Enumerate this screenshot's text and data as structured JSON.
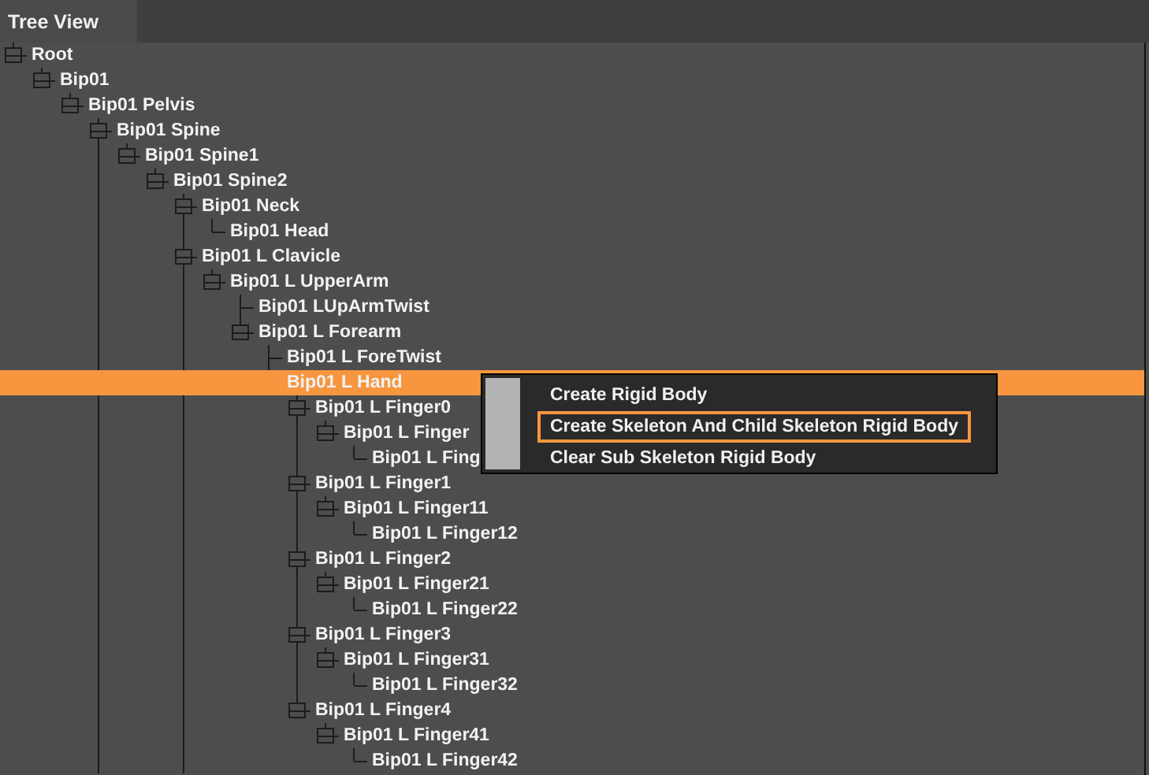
{
  "tabs": [
    {
      "label": "Tree View",
      "selected": true
    }
  ],
  "tree": [
    {
      "label": "Root",
      "selected": false,
      "children": [
        {
          "label": "Bip01",
          "selected": false,
          "children": [
            {
              "label": "Bip01 Pelvis",
              "selected": false,
              "children": [
                {
                  "label": "Bip01 Spine",
                  "selected": false,
                  "more_below": true,
                  "children": [
                    {
                      "label": "Bip01 Spine1",
                      "selected": false,
                      "children": [
                        {
                          "label": "Bip01 Spine2",
                          "selected": false,
                          "children": [
                            {
                              "label": "Bip01 Neck",
                              "selected": false,
                              "children": [
                                {
                                  "label": "Bip01 Head",
                                  "selected": false
                                }
                              ]
                            },
                            {
                              "label": "Bip01 L Clavicle",
                              "selected": false,
                              "more_below": true,
                              "children": [
                                {
                                  "label": "Bip01 L UpperArm",
                                  "selected": false,
                                  "children": [
                                    {
                                      "label": "Bip01 LUpArmTwist",
                                      "selected": false
                                    },
                                    {
                                      "label": "Bip01 L Forearm",
                                      "selected": false,
                                      "children": [
                                        {
                                          "label": "Bip01 L ForeTwist",
                                          "selected": false
                                        },
                                        {
                                          "label": "Bip01 L Hand",
                                          "selected": true,
                                          "children": [
                                            {
                                              "label": "Bip01 L Finger0",
                                              "selected": false,
                                              "children": [
                                                {
                                                  "label": "Bip01 L Finger",
                                                  "selected": false,
                                                  "children": [
                                                    {
                                                      "label": "Bip01 L Fing",
                                                      "selected": false
                                                    }
                                                  ]
                                                }
                                              ]
                                            },
                                            {
                                              "label": "Bip01 L Finger1",
                                              "selected": false,
                                              "children": [
                                                {
                                                  "label": "Bip01 L Finger11",
                                                  "selected": false,
                                                  "children": [
                                                    {
                                                      "label": "Bip01 L Finger12",
                                                      "selected": false
                                                    }
                                                  ]
                                                }
                                              ]
                                            },
                                            {
                                              "label": "Bip01 L Finger2",
                                              "selected": false,
                                              "children": [
                                                {
                                                  "label": "Bip01 L Finger21",
                                                  "selected": false,
                                                  "children": [
                                                    {
                                                      "label": "Bip01 L Finger22",
                                                      "selected": false
                                                    }
                                                  ]
                                                }
                                              ]
                                            },
                                            {
                                              "label": "Bip01 L Finger3",
                                              "selected": false,
                                              "children": [
                                                {
                                                  "label": "Bip01 L Finger31",
                                                  "selected": false,
                                                  "children": [
                                                    {
                                                      "label": "Bip01 L Finger32",
                                                      "selected": false
                                                    }
                                                  ]
                                                }
                                              ]
                                            },
                                            {
                                              "label": "Bip01 L Finger4",
                                              "selected": false,
                                              "children": [
                                                {
                                                  "label": "Bip01 L Finger41",
                                                  "selected": false,
                                                  "children": [
                                                    {
                                                      "label": "Bip01 L Finger42",
                                                      "selected": false
                                                    }
                                                  ]
                                                }
                                              ]
                                            }
                                          ]
                                        }
                                      ]
                                    }
                                  ]
                                }
                              ]
                            }
                          ]
                        }
                      ]
                    }
                  ]
                }
              ]
            }
          ]
        }
      ]
    }
  ],
  "context_menu": {
    "items": [
      {
        "label": "Create Rigid Body",
        "selected": false
      },
      {
        "label": "Create Skeleton And Child Skeleton Rigid Body",
        "selected": true
      },
      {
        "label": "Clear Sub Skeleton Rigid Body",
        "selected": false
      }
    ]
  }
}
